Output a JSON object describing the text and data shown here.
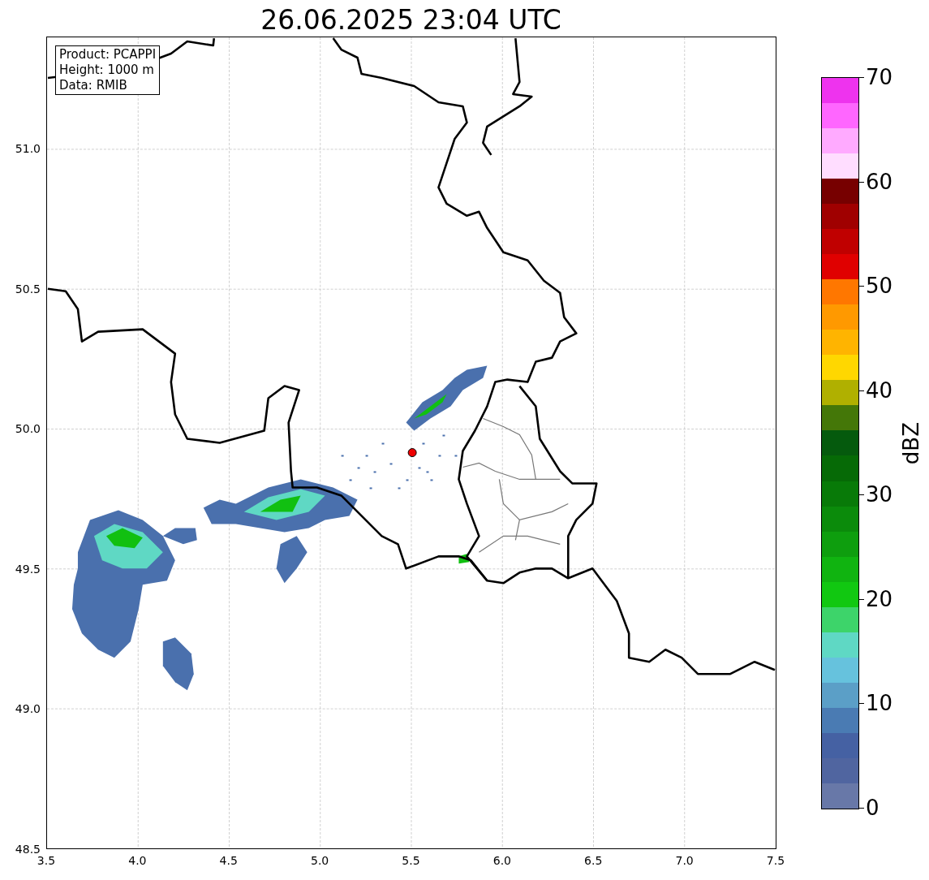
{
  "title": "26.06.2025 23:04 UTC",
  "info_box": [
    "Product: PCAPPI",
    "Height: 1000 m",
    "Data: RMIB"
  ],
  "map": {
    "xticks": [
      "3.5",
      "4.0",
      "4.5",
      "5.0",
      "5.5",
      "6.0",
      "6.5",
      "7.0",
      "7.5"
    ],
    "yticks": [
      "51.0",
      "50.5",
      "50.0",
      "49.5",
      "49.0",
      "48.5"
    ]
  },
  "colorbar": {
    "label": "dBZ",
    "ticks": [
      "70",
      "60",
      "50",
      "40",
      "30",
      "20",
      "10",
      "0"
    ],
    "segments": [
      {
        "color": "#ee33ee"
      },
      {
        "color": "#ff66ff"
      },
      {
        "color": "#ffaaff"
      },
      {
        "color": "#ffddff"
      },
      {
        "color": "#770000"
      },
      {
        "color": "#a00000"
      },
      {
        "color": "#c00000"
      },
      {
        "color": "#e00000"
      },
      {
        "color": "#ff7700"
      },
      {
        "color": "#ff9900"
      },
      {
        "color": "#ffb400"
      },
      {
        "color": "#ffd700"
      },
      {
        "color": "#b0b000"
      },
      {
        "color": "#447708"
      },
      {
        "color": "#055a0d"
      },
      {
        "color": "#066a06"
      },
      {
        "color": "#087a08"
      },
      {
        "color": "#0b8b0b"
      },
      {
        "color": "#0e9e0e"
      },
      {
        "color": "#10b410"
      },
      {
        "color": "#11c811"
      },
      {
        "color": "#3dd46a"
      },
      {
        "color": "#5fd8c4"
      },
      {
        "color": "#66c2dd"
      },
      {
        "color": "#5b9fc7"
      },
      {
        "color": "#4a7bb3"
      },
      {
        "color": "#4561a3"
      },
      {
        "color": "#5065a0"
      },
      {
        "color": "#6878a8"
      }
    ]
  }
}
